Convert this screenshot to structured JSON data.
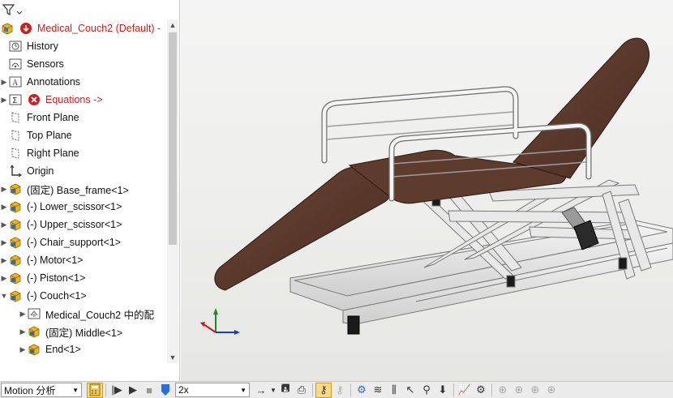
{
  "tree": {
    "root_label": "Medical_Couch2  (Default) -",
    "items": [
      {
        "label": "History",
        "icon": "history-icon",
        "color": "black",
        "expand": false
      },
      {
        "label": "Sensors",
        "icon": "sensors-icon",
        "color": "black",
        "expand": false
      },
      {
        "label": "Annotations",
        "icon": "annotations-icon",
        "color": "black",
        "expand": true
      },
      {
        "label": "Equations ->",
        "icon": "equations-icon",
        "color": "red",
        "expand": true
      },
      {
        "label": "Front Plane",
        "icon": "plane-icon",
        "color": "black",
        "expand": false
      },
      {
        "label": "Top Plane",
        "icon": "plane-icon",
        "color": "black",
        "expand": false
      },
      {
        "label": "Right Plane",
        "icon": "plane-icon",
        "color": "black",
        "expand": false
      },
      {
        "label": "Origin",
        "icon": "origin-icon",
        "color": "black",
        "expand": false
      },
      {
        "label": "(固定) Base_frame<1>",
        "icon": "part-icon",
        "color": "black",
        "expand": true
      },
      {
        "label": "(-) Lower_scissor<1>",
        "icon": "part-icon",
        "color": "black",
        "expand": true
      },
      {
        "label": "(-) Upper_scissor<1>",
        "icon": "part-icon",
        "color": "black",
        "expand": true
      },
      {
        "label": "(-) Chair_support<1>",
        "icon": "part-icon",
        "color": "black",
        "expand": true
      },
      {
        "label": "(-) Motor<1>",
        "icon": "part-icon",
        "color": "black",
        "expand": true
      },
      {
        "label": "(-) Piston<1>",
        "icon": "part-icon",
        "color": "black",
        "expand": true
      },
      {
        "label": "(-) Couch<1>",
        "icon": "part-icon",
        "color": "black",
        "expand": true,
        "expanded": true
      },
      {
        "label": "Medical_Couch2 中的配",
        "icon": "mates-icon",
        "color": "black",
        "expand": true,
        "indent": 1
      },
      {
        "label": "(固定) Middle<1>",
        "icon": "part-icon",
        "color": "black",
        "expand": true,
        "indent": 1
      },
      {
        "label": "End<1>",
        "icon": "part-icon",
        "color": "black",
        "expand": true,
        "indent": 1
      }
    ]
  },
  "toolbar": {
    "study_select": "Motion 分析",
    "speed_select": "2x"
  },
  "colors": {
    "cushion": "#5a3a2c",
    "frame": "#e4e4e4",
    "frame_edge": "#7a7a7a",
    "accent_red": "#c8201e",
    "part_yellow": "#f2b41a",
    "part_blue": "#2d6fb5"
  }
}
